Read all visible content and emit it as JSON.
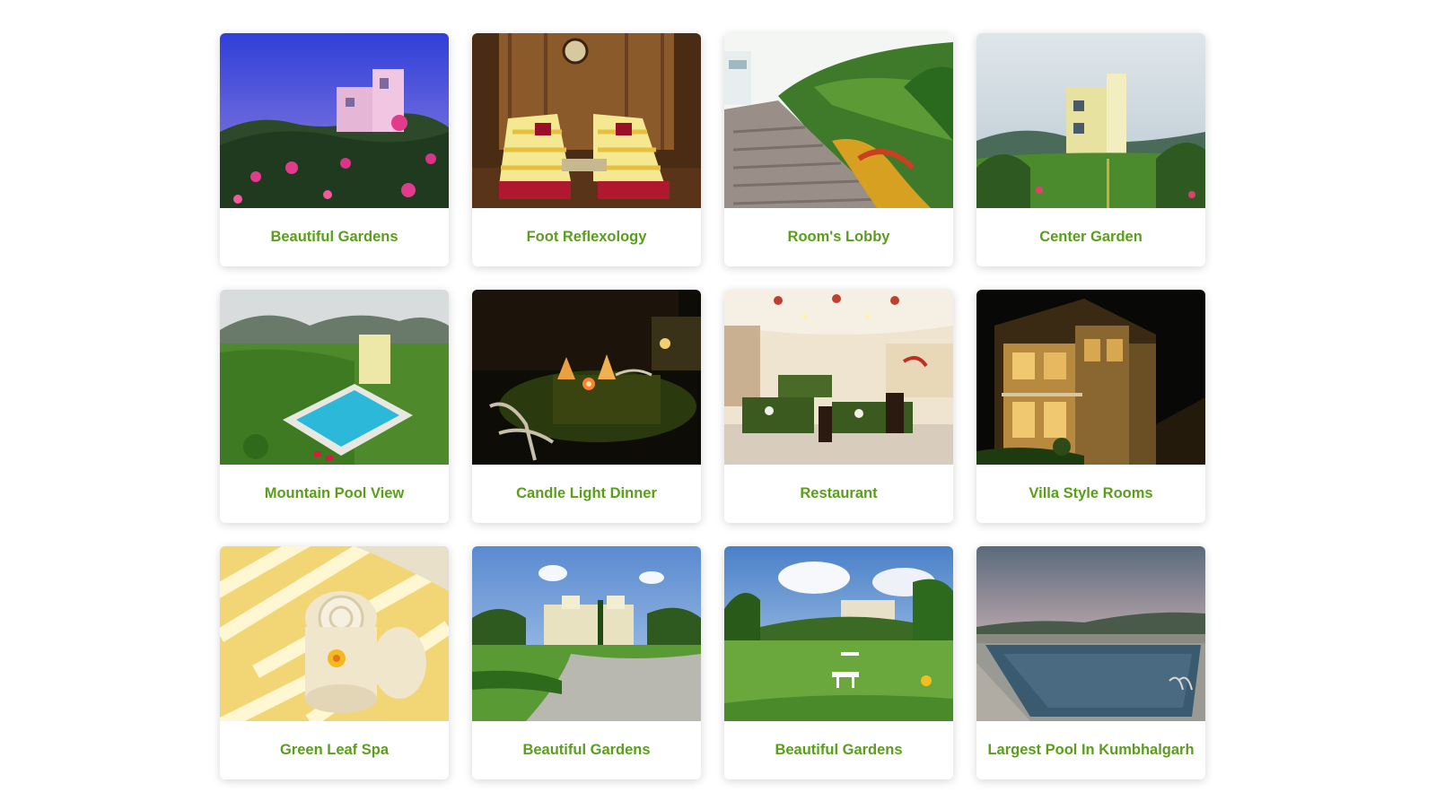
{
  "accent_color": "#5a9e1c",
  "gallery": {
    "items": [
      {
        "caption": "Beautiful Gardens",
        "image": "villa-with-pink-flowers-photo"
      },
      {
        "caption": "Foot Reflexology",
        "image": "spa-loungers-room-photo"
      },
      {
        "caption": "Room's Lobby",
        "image": "stone-pathway-plants-photo"
      },
      {
        "caption": "Center Garden",
        "image": "villa-lawn-garden-photo"
      },
      {
        "caption": "Mountain Pool View",
        "image": "aerial-pool-mountains-photo"
      },
      {
        "caption": "Candle Light Dinner",
        "image": "night-candle-table-photo"
      },
      {
        "caption": "Restaurant",
        "image": "restaurant-dining-hall-photo"
      },
      {
        "caption": "Villa Style Rooms",
        "image": "villas-at-night-photo"
      },
      {
        "caption": "Green Leaf Spa",
        "image": "rolled-towels-flower-photo"
      },
      {
        "caption": "Beautiful Gardens",
        "image": "resort-driveway-garden-photo"
      },
      {
        "caption": "Beautiful Gardens",
        "image": "lawn-with-tables-photo"
      },
      {
        "caption": "Largest Pool In Kumbhalgarh",
        "image": "pool-at-dusk-photo"
      }
    ]
  }
}
